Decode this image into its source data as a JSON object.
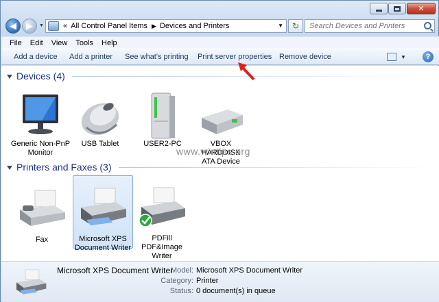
{
  "window": {
    "minimize_icon": "minimize-icon",
    "maximize_icon": "maximize-icon",
    "close_icon": "close-icon"
  },
  "address": {
    "crumbs": [
      "All Control Panel Items",
      "Devices and Printers"
    ],
    "prefix": "«",
    "separator": "▶"
  },
  "search": {
    "placeholder": "Search Devices and Printers"
  },
  "menu": {
    "items": [
      "File",
      "Edit",
      "View",
      "Tools",
      "Help"
    ]
  },
  "commands": {
    "add_device": "Add a device",
    "add_printer": "Add a printer",
    "see_printing": "See what's printing",
    "print_server": "Print server properties",
    "remove_device": "Remove device",
    "help": "?"
  },
  "devices_group": {
    "title": "Devices (4)",
    "items": [
      {
        "label_line1": "Generic Non-PnP",
        "label_line2": "Monitor",
        "icon": "monitor-icon"
      },
      {
        "label_line1": "USB Tablet",
        "label_line2": "",
        "icon": "mouse-icon"
      },
      {
        "label_line1": "USER2-PC",
        "label_line2": "",
        "icon": "computer-tower-icon"
      },
      {
        "label_line1": "VBOX HARDDISK",
        "label_line2": "ATA Device",
        "icon": "hard-disk-icon"
      }
    ]
  },
  "printers_group": {
    "title": "Printers and Faxes (3)",
    "items": [
      {
        "label_line1": "Fax",
        "label_line2": "",
        "label_line3": "",
        "icon": "fax-icon"
      },
      {
        "label_line1": "Microsoft XPS",
        "label_line2": "Document Writer",
        "label_line3": "",
        "icon": "printer-icon",
        "selected": true
      },
      {
        "label_line1": "PDFill",
        "label_line2": "PDF&Image",
        "label_line3": "Writer",
        "icon": "printer-default-icon"
      }
    ]
  },
  "watermark": "www.wintips.org",
  "details": {
    "name": "Microsoft XPS Document Writer",
    "model_key": "Model:",
    "model_val": "Microsoft XPS Document Writer",
    "category_key": "Category:",
    "category_val": "Printer",
    "status_key": "Status:",
    "status_val": "0 document(s) in queue"
  },
  "colors": {
    "group_title": "#1e3287",
    "accent_arrow": "#e0201b",
    "selection": "#d0e3f8"
  }
}
